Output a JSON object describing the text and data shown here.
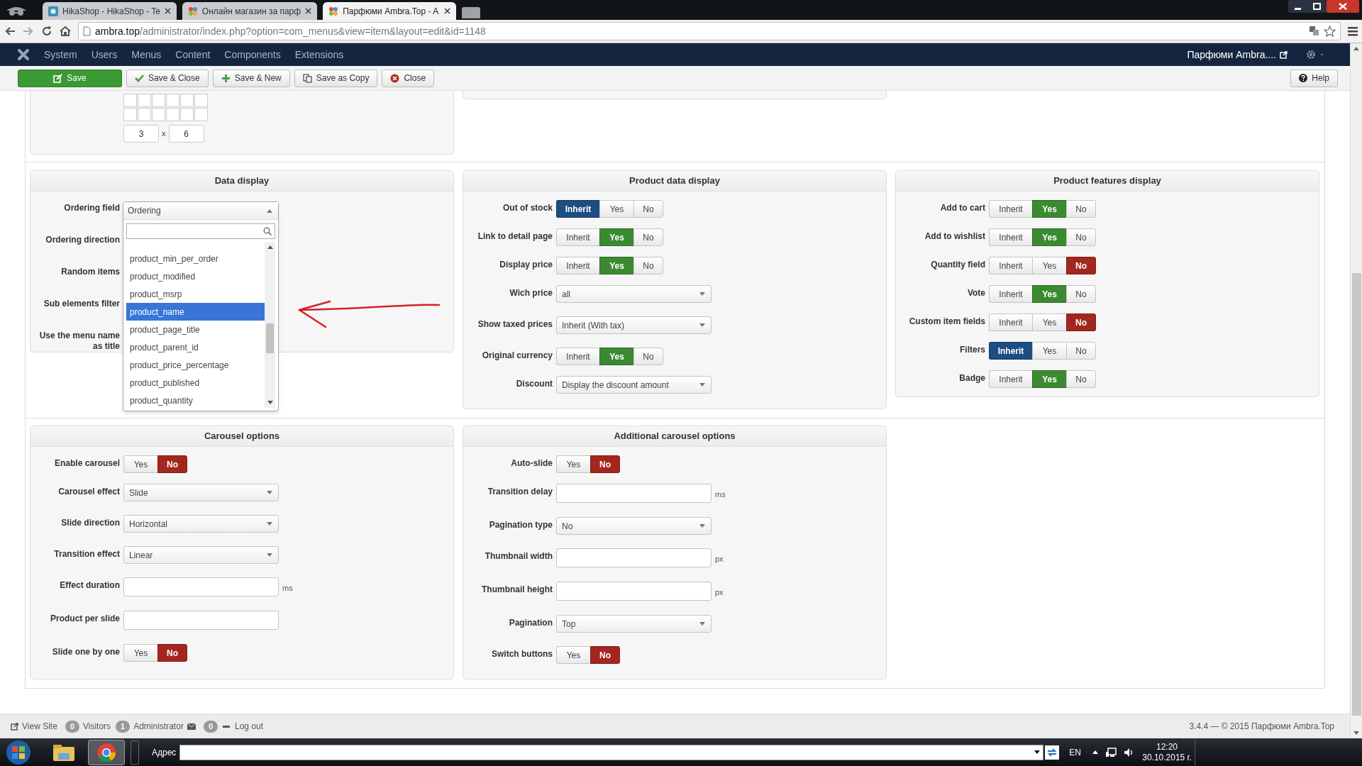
{
  "browser": {
    "tabs": [
      {
        "title": "HikaShop - HikaShop - Te",
        "selected": false,
        "kind": "hika"
      },
      {
        "title": "Онлайн магазин за парф",
        "selected": false,
        "kind": "joomla"
      },
      {
        "title": "Парфюми Ambra.Top - A",
        "selected": true,
        "kind": "joomla"
      }
    ],
    "url_host": "ambra.top",
    "url_path": "/administrator/index.php?option=com_menus&view=item&layout=edit&id=1148"
  },
  "navbar": {
    "menu": [
      "System",
      "Users",
      "Menus",
      "Content",
      "Components",
      "Extensions"
    ],
    "site_link": "Парфюми Ambra...."
  },
  "toolbar": {
    "buttons": [
      {
        "label": "Save",
        "kind": "save"
      },
      {
        "label": "Save & Close",
        "kind": "check"
      },
      {
        "label": "Save & New",
        "kind": "plus"
      },
      {
        "label": "Save as Copy",
        "kind": "copy"
      },
      {
        "label": "Close",
        "kind": "close"
      }
    ],
    "help": "Help"
  },
  "grid_picker": {
    "size_a": "3",
    "separator": "x",
    "size_b": "6"
  },
  "data_display": {
    "title": "Data display",
    "labels": [
      "Ordering field",
      "Ordering direction",
      "Random items",
      "Sub elements filter",
      "Use the menu name as title"
    ],
    "dropdown": {
      "value": "Ordering",
      "items": [
        {
          "label": "product_min_per_order",
          "selected": false
        },
        {
          "label": "product_modified",
          "selected": false
        },
        {
          "label": "product_msrp",
          "selected": false
        },
        {
          "label": "product_name",
          "selected": true
        },
        {
          "label": "product_page_title",
          "selected": false
        },
        {
          "label": "product_parent_id",
          "selected": false
        },
        {
          "label": "product_price_percentage",
          "selected": false
        },
        {
          "label": "product_published",
          "selected": false
        },
        {
          "label": "product_quantity",
          "selected": false
        }
      ]
    }
  },
  "panels": [
    {
      "title": "Product data display",
      "rows": [
        {
          "label": "Out of stock",
          "kind": "toggle",
          "options": [
            {
              "label": "Inherit",
              "kind": "inherit",
              "selected": true
            },
            {
              "label": "Yes",
              "kind": "yes",
              "selected": false
            },
            {
              "label": "No",
              "kind": "no",
              "selected": false
            }
          ]
        },
        {
          "label": "Link to detail page",
          "kind": "toggle",
          "options": [
            {
              "label": "Inherit",
              "kind": "inherit",
              "selected": false
            },
            {
              "label": "Yes",
              "kind": "yes",
              "selected": true
            },
            {
              "label": "No",
              "kind": "no",
              "selected": false
            }
          ]
        },
        {
          "label": "Display price",
          "kind": "toggle",
          "options": [
            {
              "label": "Inherit",
              "kind": "inherit",
              "selected": false
            },
            {
              "label": "Yes",
              "kind": "yes",
              "selected": true
            },
            {
              "label": "No",
              "kind": "no",
              "selected": false
            }
          ]
        },
        {
          "label": "Wich price",
          "kind": "select",
          "value": "all"
        },
        {
          "label": "Show taxed prices",
          "kind": "select",
          "value": "Inherit (With tax)"
        },
        {
          "label": "Original currency",
          "kind": "toggle",
          "options": [
            {
              "label": "Inherit",
              "kind": "inherit",
              "selected": false
            },
            {
              "label": "Yes",
              "kind": "yes",
              "selected": true
            },
            {
              "label": "No",
              "kind": "no",
              "selected": false
            }
          ]
        },
        {
          "label": "Discount",
          "kind": "select",
          "value": "Display the discount amount"
        }
      ]
    },
    {
      "title": "Product features display",
      "rows": [
        {
          "label": "Add to cart",
          "kind": "toggle",
          "options": [
            {
              "label": "Inherit",
              "kind": "inherit",
              "selected": false
            },
            {
              "label": "Yes",
              "kind": "yes",
              "selected": true
            },
            {
              "label": "No",
              "kind": "no",
              "selected": false
            }
          ]
        },
        {
          "label": "Add to wishlist",
          "kind": "toggle",
          "options": [
            {
              "label": "Inherit",
              "kind": "inherit",
              "selected": false
            },
            {
              "label": "Yes",
              "kind": "yes",
              "selected": true
            },
            {
              "label": "No",
              "kind": "no",
              "selected": false
            }
          ]
        },
        {
          "label": "Quantity field",
          "kind": "toggle",
          "options": [
            {
              "label": "Inherit",
              "kind": "inherit",
              "selected": false
            },
            {
              "label": "Yes",
              "kind": "yes",
              "selected": false
            },
            {
              "label": "No",
              "kind": "no",
              "selected": true
            }
          ]
        },
        {
          "label": "Vote",
          "kind": "toggle",
          "options": [
            {
              "label": "Inherit",
              "kind": "inherit",
              "selected": false
            },
            {
              "label": "Yes",
              "kind": "yes",
              "selected": true
            },
            {
              "label": "No",
              "kind": "no",
              "selected": false
            }
          ]
        },
        {
          "label": "Custom item fields",
          "kind": "toggle",
          "options": [
            {
              "label": "Inherit",
              "kind": "inherit",
              "selected": false
            },
            {
              "label": "Yes",
              "kind": "yes",
              "selected": false
            },
            {
              "label": "No",
              "kind": "no",
              "selected": true
            }
          ]
        },
        {
          "label": "Filters",
          "kind": "toggle",
          "options": [
            {
              "label": "Inherit",
              "kind": "inherit",
              "selected": true
            },
            {
              "label": "Yes",
              "kind": "yes",
              "selected": false
            },
            {
              "label": "No",
              "kind": "no",
              "selected": false
            }
          ]
        },
        {
          "label": "Badge",
          "kind": "toggle",
          "options": [
            {
              "label": "Inherit",
              "kind": "inherit",
              "selected": false
            },
            {
              "label": "Yes",
              "kind": "yes",
              "selected": true
            },
            {
              "label": "No",
              "kind": "no",
              "selected": false
            }
          ]
        }
      ]
    },
    {
      "title": "Carousel options",
      "rows": [
        {
          "label": "Enable carousel",
          "kind": "toggle",
          "options": [
            {
              "label": "Yes",
              "kind": "yes",
              "selected": false
            },
            {
              "label": "No",
              "kind": "no",
              "selected": true
            }
          ]
        },
        {
          "label": "Carousel effect",
          "kind": "select",
          "value": "Slide"
        },
        {
          "label": "Slide direction",
          "kind": "select",
          "value": "Horizontal"
        },
        {
          "label": "Transition effect",
          "kind": "select",
          "value": "Linear"
        },
        {
          "label": "Effect duration",
          "kind": "input",
          "unit": "ms"
        },
        {
          "label": "Product per slide",
          "kind": "input"
        },
        {
          "label": "Slide one by one",
          "kind": "toggle",
          "options": [
            {
              "label": "Yes",
              "kind": "yes",
              "selected": false
            },
            {
              "label": "No",
              "kind": "no",
              "selected": true
            }
          ]
        }
      ]
    },
    {
      "title": "Additional carousel options",
      "rows": [
        {
          "label": "Auto-slide",
          "kind": "toggle",
          "options": [
            {
              "label": "Yes",
              "kind": "yes",
              "selected": false
            },
            {
              "label": "No",
              "kind": "no",
              "selected": true
            }
          ]
        },
        {
          "label": "Transition delay",
          "kind": "input",
          "unit": "ms"
        },
        {
          "label": "Pagination type",
          "kind": "select",
          "value": "No"
        },
        {
          "label": "Thumbnail width",
          "kind": "input",
          "unit": "px"
        },
        {
          "label": "Thumbnail height",
          "kind": "input",
          "unit": "px"
        },
        {
          "label": "Pagination",
          "kind": "select",
          "value": "Top"
        },
        {
          "label": "Switch buttons",
          "kind": "toggle",
          "options": [
            {
              "label": "Yes",
              "kind": "yes",
              "selected": false
            },
            {
              "label": "No",
              "kind": "no",
              "selected": true
            }
          ]
        }
      ]
    }
  ],
  "status_bar": {
    "view_site": "View Site",
    "visitors_count": "0",
    "visitors": "Visitors",
    "admins_count": "1",
    "admins": "Administrator",
    "messages_count": "0",
    "logout": "Log out",
    "version": "3.4.4 — © 2015 Парфюми Ambra.Top"
  },
  "taskbar": {
    "address_label": "Адрес",
    "language": "EN",
    "time": "12:20",
    "date": "30.10.2015 г."
  }
}
